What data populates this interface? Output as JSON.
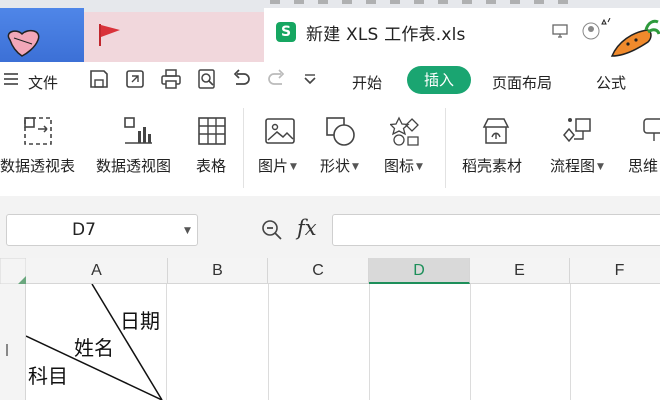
{
  "window": {
    "doc_title": "新建 XLS 工作表.xls",
    "doc_logo": "S"
  },
  "menu": {
    "file_label": "文件",
    "tabs": [
      {
        "label": "开始",
        "active": false
      },
      {
        "label": "插入",
        "active": true
      },
      {
        "label": "页面布局",
        "active": false
      },
      {
        "label": "公式",
        "active": false
      }
    ]
  },
  "quick_access": [
    "save-icon",
    "export-icon",
    "print-icon",
    "print-preview-icon",
    "undo-icon",
    "redo-icon",
    "more-dropdown-icon"
  ],
  "ribbon": {
    "items": [
      {
        "label": "数据透视表",
        "icon": "pivot-table-icon"
      },
      {
        "label": "数据透视图",
        "icon": "pivot-chart-icon"
      },
      {
        "label": "表格",
        "icon": "table-icon"
      },
      {
        "label": "图片",
        "icon": "picture-icon",
        "dropdown": true
      },
      {
        "label": "形状",
        "icon": "shape-icon",
        "dropdown": true
      },
      {
        "label": "图标",
        "icon": "icon-library-icon",
        "dropdown": true
      },
      {
        "label": "稻壳素材",
        "icon": "docer-material-icon"
      },
      {
        "label": "流程图",
        "icon": "flowchart-icon",
        "dropdown": true
      },
      {
        "label": "思维",
        "icon": "mindmap-icon"
      }
    ]
  },
  "formula_bar": {
    "cell_ref": "D7",
    "fx_label": "fx",
    "formula_value": ""
  },
  "sheet": {
    "columns": [
      "A",
      "B",
      "C",
      "D",
      "E",
      "F"
    ],
    "selected_column": "D",
    "cell_a_text": {
      "date": "日期",
      "name": "姓名",
      "subject": "科目"
    }
  },
  "colors": {
    "accent": "#1aa571",
    "selected_column": "#1d8f5a",
    "tab_blue": "#4f86e8"
  }
}
